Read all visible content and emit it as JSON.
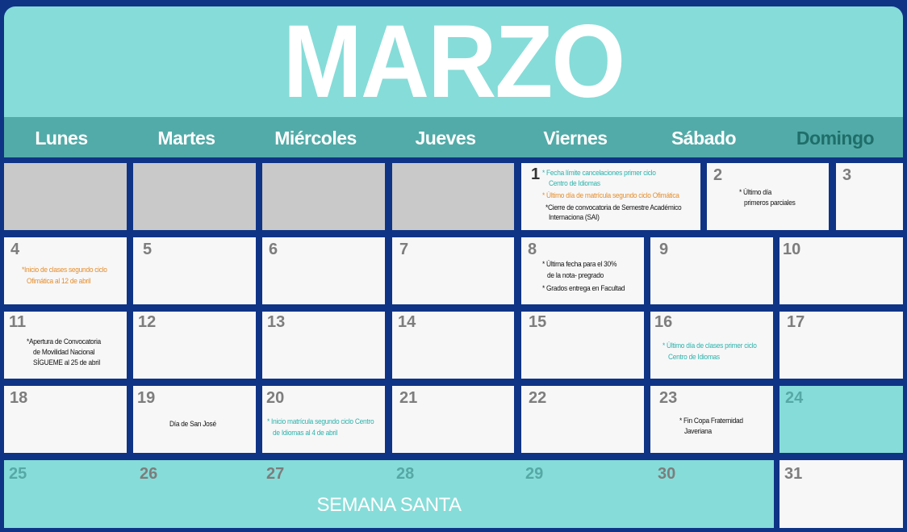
{
  "month": "MARZO",
  "weekdays": [
    "Lunes",
    "Martes",
    "Miércoles",
    "Jueves",
    "Viernes",
    "Sábado",
    "Domingo"
  ],
  "days": {
    "d1": "1",
    "d2": "2",
    "d3": "3",
    "d4": "4",
    "d5": "5",
    "d6": "6",
    "d7": "7",
    "d8": "8",
    "d9": "9",
    "d10": "10",
    "d11": "11",
    "d12": "12",
    "d13": "13",
    "d14": "14",
    "d15": "15",
    "d16": "16",
    "d17": "17",
    "d18": "18",
    "d19": "19",
    "d20": "20",
    "d21": "21",
    "d22": "22",
    "d23": "23",
    "d24": "24",
    "d25": "25",
    "d26": "26",
    "d27": "27",
    "d28": "28",
    "d29": "29",
    "d30": "30",
    "d31": "31"
  },
  "events": {
    "d1_a1": "* Fecha límite cancelaciones primer ciclo",
    "d1_a2": "Centro de Idiomas",
    "d1_b": "* Último día de matrícula segundo ciclo Ofimática",
    "d1_c1": "*Cierre de convocatoria de Semestre Académico",
    "d1_c2": "Internaciona (SAI)",
    "d2_1": "* Último día",
    "d2_2": "primeros parciales",
    "d4_1": "*Inicio de clases segundo ciclo",
    "d4_2": "Ofimática al 12 de abril",
    "d8_1": "* Última fecha para el 30%",
    "d8_2": "de la nota- pregrado",
    "d8_3": "* Grados entrega en Facultad",
    "d11_1": "*Apertura de Convocatoria",
    "d11_2": "de Movilidad Nacional",
    "d11_3": "SÍGUEME al 25 de abril",
    "d16_1": "* Último día de clases primer ciclo",
    "d16_2": "Centro de Idiomas",
    "d19": "Día de San José",
    "d20_1": "* Inicio matrícula segundo ciclo Centro",
    "d20_2": "de Idiomas al 4 de abril",
    "d23_1": "* Fin Copa Fraternidad",
    "d23_2": "Javeriana"
  },
  "semana_santa": "SEMANA SANTA",
  "colors": {
    "border": "#0f3486",
    "header": "#86dcd8",
    "weekday_bar": "#52aba8",
    "cell": "#f7f7f8",
    "empty_cell": "#c9c9c9",
    "teal_text": "#2bb3ab",
    "orange_text": "#e58d2a"
  }
}
